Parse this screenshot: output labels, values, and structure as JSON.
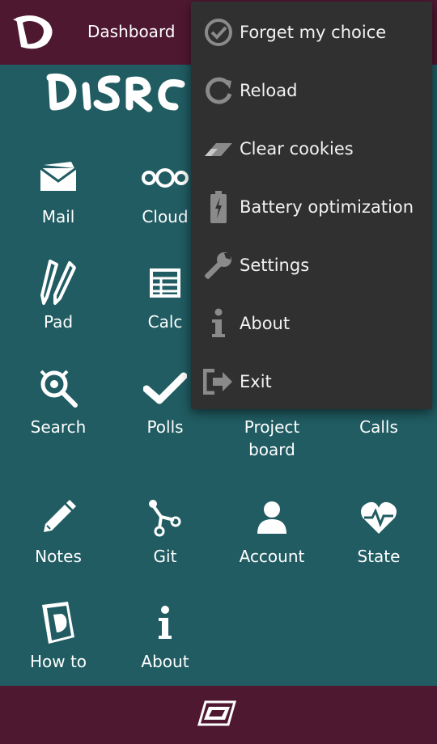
{
  "header": {
    "title": "Dashboard"
  },
  "tiles": [
    {
      "label": "Mail",
      "icon": "mail-icon"
    },
    {
      "label": "Cloud",
      "icon": "cloud-icon"
    },
    {
      "label": "Pad",
      "icon": "pad-icon"
    },
    {
      "label": "Calc",
      "icon": "calc-icon"
    },
    {
      "label": "Search",
      "icon": "search-icon"
    },
    {
      "label": "Polls",
      "icon": "polls-icon"
    },
    {
      "label": "Project board",
      "icon": "project-board-icon"
    },
    {
      "label": "Calls",
      "icon": "calls-icon"
    },
    {
      "label": "Notes",
      "icon": "notes-icon"
    },
    {
      "label": "Git",
      "icon": "git-icon"
    },
    {
      "label": "Account",
      "icon": "account-icon"
    },
    {
      "label": "State",
      "icon": "state-icon"
    },
    {
      "label": "How to",
      "icon": "how-to-icon"
    },
    {
      "label": "About",
      "icon": "about-icon"
    }
  ],
  "menu": {
    "items": [
      {
        "label": "Forget my choice",
        "icon": "check-circle-icon"
      },
      {
        "label": "Reload",
        "icon": "reload-icon"
      },
      {
        "label": "Clear cookies",
        "icon": "eraser-icon"
      },
      {
        "label": "Battery optimization",
        "icon": "battery-icon"
      },
      {
        "label": "Settings",
        "icon": "wrench-icon"
      },
      {
        "label": "About",
        "icon": "info-icon"
      },
      {
        "label": "Exit",
        "icon": "exit-icon"
      }
    ]
  },
  "colors": {
    "header": "#4f1831",
    "background": "#205c62",
    "menu": "#303030",
    "menu_icon": "#8a8a8a"
  }
}
